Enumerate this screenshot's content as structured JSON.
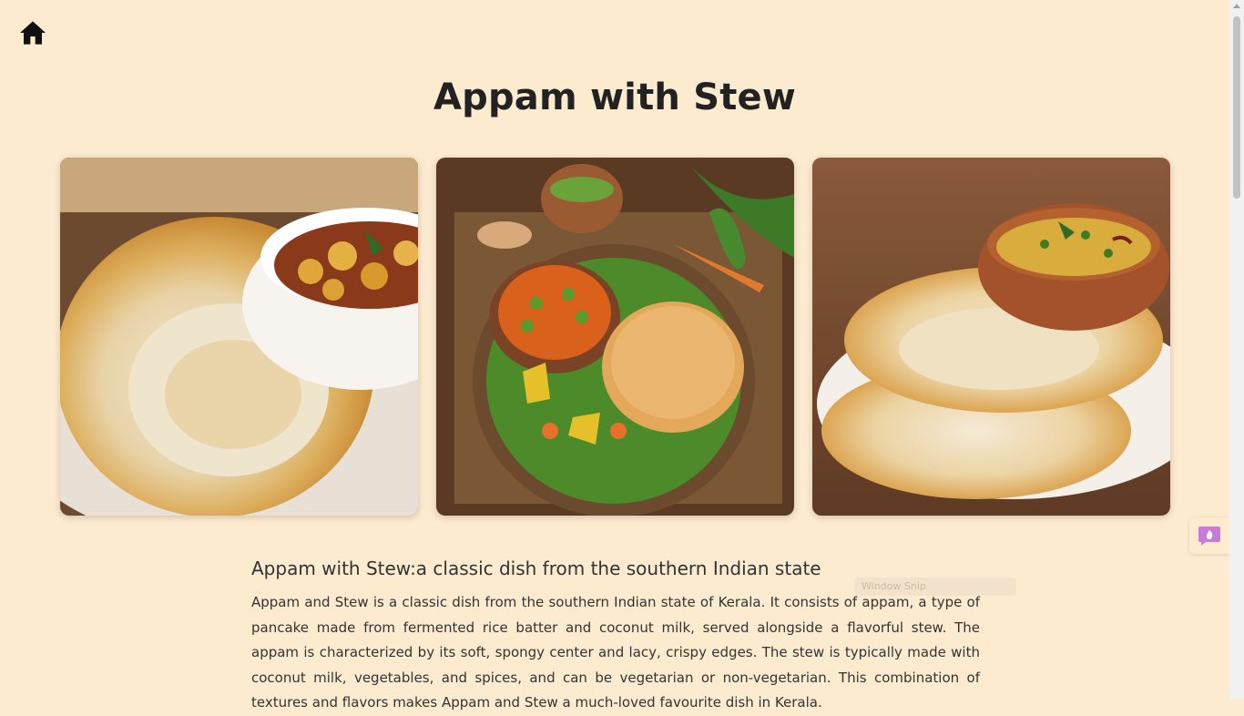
{
  "page": {
    "title": "Appam with Stew"
  },
  "nav": {
    "home_icon": "home-icon"
  },
  "gallery": {
    "images": [
      {
        "alt": "Appam with potato stew",
        "icon": "appam-stew-photo-1"
      },
      {
        "alt": "Appam with vegetable stew on banana leaf",
        "icon": "appam-stew-photo-2"
      },
      {
        "alt": "Appam with egg curry",
        "icon": "appam-stew-photo-3"
      }
    ]
  },
  "article": {
    "heading": "Appam with Stew:a classic dish from the southern Indian state",
    "body": "Appam and Stew is a classic dish from the southern Indian state of Kerala. It consists of appam, a type of pancake made from fermented rice batter and coconut milk, served alongside a flavorful stew. The appam is characterized by its soft, spongy center and lacy, crispy edges. The stew is typically made with coconut milk, vegetables, and spices, and can be vegetarian or non-vegetarian. This combination of textures and flavors makes Appam and Stew a much-loved favourite dish in Kerala."
  },
  "ghost_bar": {
    "label": "Window Snip"
  },
  "colors": {
    "background": "#fdebd0",
    "text": "#333333",
    "accent_widget": "#c77dd6"
  }
}
